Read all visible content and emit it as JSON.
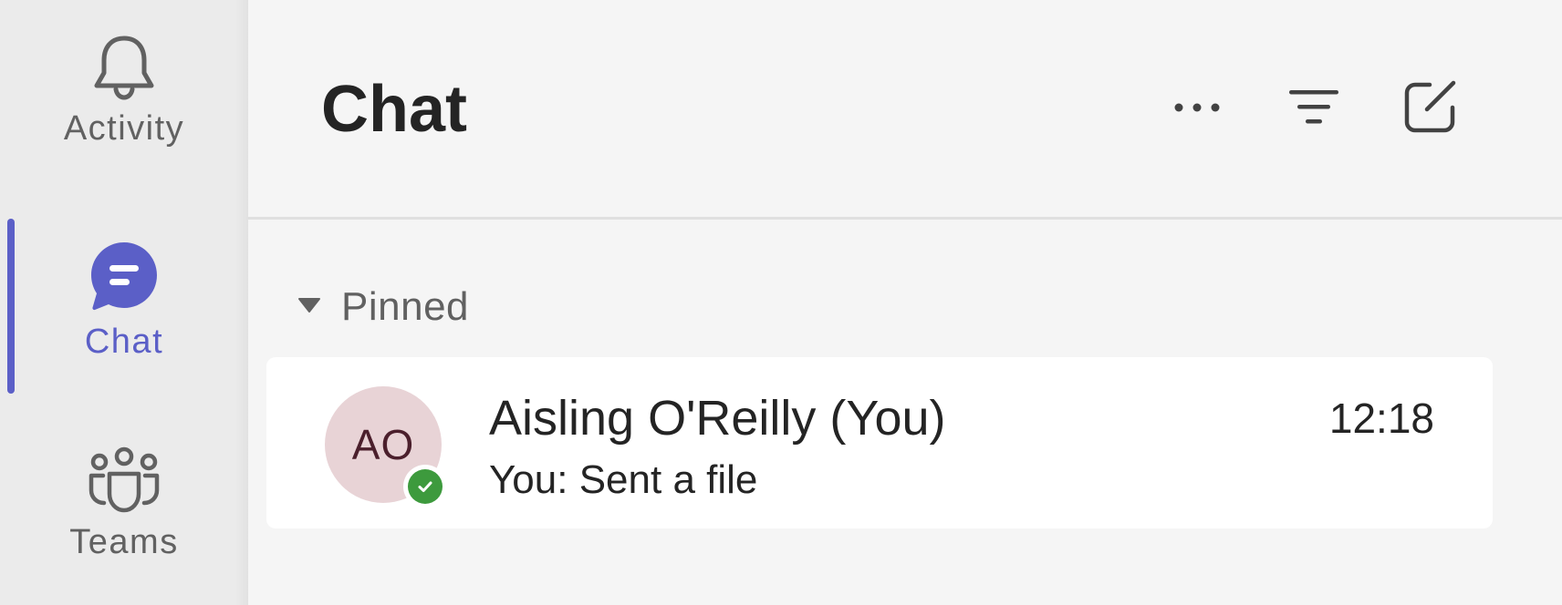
{
  "rail": {
    "items": [
      {
        "label": "Activity",
        "icon": "bell-icon",
        "active": false
      },
      {
        "label": "Chat",
        "icon": "chat-bubble-icon",
        "active": true
      },
      {
        "label": "Teams",
        "icon": "teams-icon",
        "active": false
      }
    ]
  },
  "header": {
    "title": "Chat",
    "actions": [
      {
        "icon": "more-options-icon"
      },
      {
        "icon": "filter-icon"
      },
      {
        "icon": "new-chat-icon"
      }
    ]
  },
  "sections": [
    {
      "label": "Pinned",
      "expanded": true,
      "chats": [
        {
          "initials": "AO",
          "name": "Aisling O'Reilly (You)",
          "time": "12:18",
          "preview": "You: Sent a file",
          "presence": "available"
        }
      ]
    }
  ],
  "colors": {
    "accent": "#5b5fc7",
    "rail_background": "#ebebeb",
    "panel_background": "#f5f5f5",
    "card_background": "#ffffff",
    "avatar_background": "#e8d3d6",
    "presence_available": "#3d9a3d"
  }
}
